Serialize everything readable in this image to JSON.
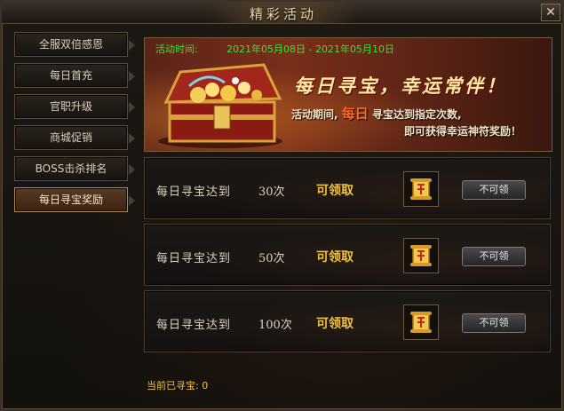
{
  "window": {
    "title": "精彩活动",
    "close_label": "✕"
  },
  "sidebar": {
    "items": [
      {
        "label": "全服双倍感恩"
      },
      {
        "label": "每日首充"
      },
      {
        "label": "官职升级"
      },
      {
        "label": "商城促销"
      },
      {
        "label": "BOSS击杀排名"
      },
      {
        "label": "每日寻宝奖励",
        "active": true
      }
    ]
  },
  "banner": {
    "time_label": "活动时间:",
    "time_value": "2021年05月08日 - 2021年05月10日",
    "headline": "每日寻宝，幸运常伴！",
    "line1_prefix": "活动期间,",
    "line1_highlight": "每日",
    "line1_suffix": "寻宝达到指定次数,",
    "line2": "即可获得幸运神符奖励！"
  },
  "rewards": [
    {
      "goal": "每日寻宝达到",
      "count": "30次",
      "status": "可领取",
      "reward_icon": "scroll-icon",
      "button": "不可领"
    },
    {
      "goal": "每日寻宝达到",
      "count": "50次",
      "status": "可领取",
      "reward_icon": "scroll-icon",
      "button": "不可领"
    },
    {
      "goal": "每日寻宝达到",
      "count": "100次",
      "status": "可领取",
      "reward_icon": "scroll-icon",
      "button": "不可领"
    }
  ],
  "footer": {
    "treasure_label": "当前已寻宝:",
    "treasure_count": "0"
  },
  "colors": {
    "accent_gold": "#f0c23a",
    "time_green": "#36e236",
    "highlight_orange": "#ff6a28"
  }
}
